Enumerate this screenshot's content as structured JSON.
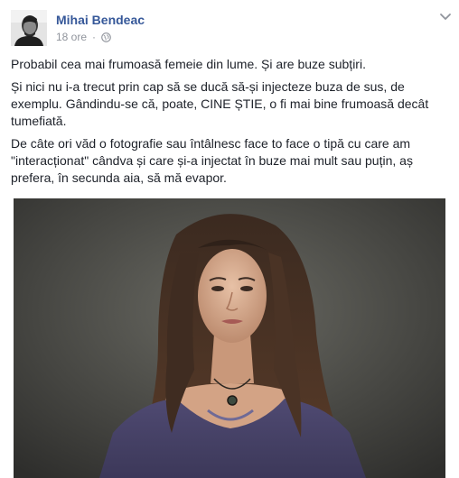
{
  "post": {
    "author": "Mihai Bendeac",
    "time": "18 ore",
    "separator": "·",
    "privacy_icon": "globe-icon",
    "menu_icon": "chevron-down-icon",
    "paragraphs": [
      "Probabil cea mai frumoasă femeie din lume. Și are buze subțiri.",
      "Și nici nu i-a trecut prin cap să se ducă să-și injecteze buza de sus, de exemplu. Gândindu-se că, poate, CINE ȘTIE, o fi mai bine frumoasă decât tumefiată.",
      "De câte ori văd o fotografie sau întâlnesc face to face o tipă cu care am \"interacționat\" cândva și care și-a injectat în buze mai mult sau puțin, aș prefera, în secunda aia, să mă evapor."
    ],
    "colors": {
      "author": "#365899",
      "meta": "#90949c",
      "text": "#1d2129"
    }
  }
}
